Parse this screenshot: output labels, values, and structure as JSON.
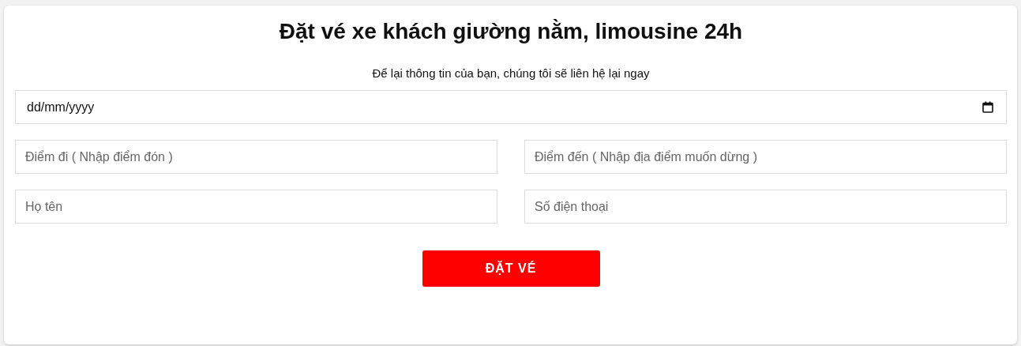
{
  "title": "Đặt vé xe khách giường nằm, limousine 24h",
  "subtitle": "Để lại thông tin của bạn, chúng tôi sẽ liên hệ lại ngay",
  "date_field": {
    "placeholder": "dd/mm/yyyy"
  },
  "fields": [
    {
      "placeholder": "Điểm đi ( Nhập điểm đón )"
    },
    {
      "placeholder": "Điểm đến ( Nhập địa điểm muốn dừng )"
    },
    {
      "placeholder": "Họ tên"
    },
    {
      "placeholder": "Số điện thoại"
    }
  ],
  "submit_button": {
    "label": "ĐẶT VÉ"
  }
}
